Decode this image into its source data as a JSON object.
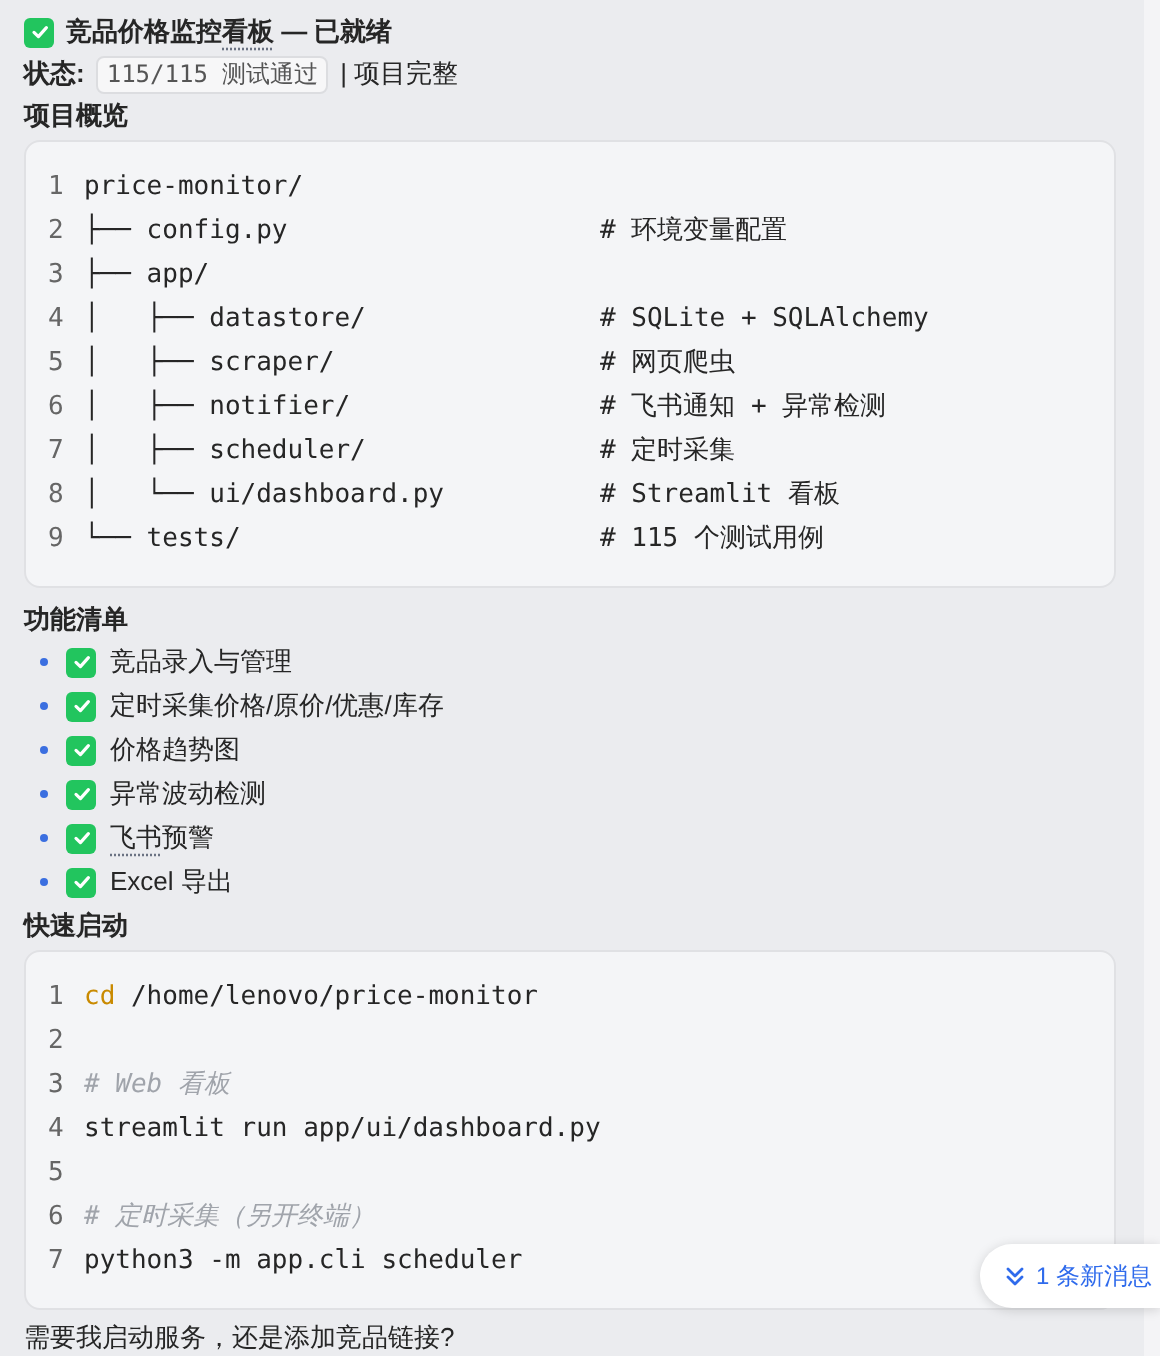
{
  "header": {
    "checked": true,
    "title": [
      {
        "text": "竞品价格监控",
        "term": false
      },
      {
        "text": "看板",
        "term": true
      },
      {
        "text": " — 已就绪",
        "term": false
      }
    ]
  },
  "status": {
    "label": "状态:",
    "code": "115/115 测试通过",
    "text": "| 项目完整"
  },
  "overview": {
    "heading": "项目概览",
    "lines": [
      {
        "number": "1",
        "path": "price-monitor/"
      },
      {
        "number": "2",
        "path": "├── config.py",
        "comment": "# 环境变量配置"
      },
      {
        "number": "3",
        "path": "├── app/"
      },
      {
        "number": "4",
        "path": "│   ├── datastore/",
        "comment": "# SQLite + SQLAlchemy"
      },
      {
        "number": "5",
        "path": "│   ├── scraper/",
        "comment": "# 网页爬虫"
      },
      {
        "number": "6",
        "path": "│   ├── notifier/",
        "comment": "# 飞书通知 + 异常检测"
      },
      {
        "number": "7",
        "path": "│   ├── scheduler/",
        "comment": "# 定时采集"
      },
      {
        "number": "8",
        "path": "│   └── ui/dashboard.py",
        "comment": "# Streamlit 看板"
      },
      {
        "number": "9",
        "path": "└── tests/",
        "comment": "# 115 个测试用例"
      }
    ]
  },
  "features": {
    "heading": "功能清单",
    "items": [
      {
        "checked": true,
        "segments": [
          {
            "text": "竞品录入与管理",
            "term": false
          }
        ]
      },
      {
        "checked": true,
        "segments": [
          {
            "text": "定时采集价格/原价/优惠/库存",
            "term": false
          }
        ]
      },
      {
        "checked": true,
        "segments": [
          {
            "text": "价格趋势图",
            "term": false
          }
        ]
      },
      {
        "checked": true,
        "segments": [
          {
            "text": "异常波动检测",
            "term": false
          }
        ]
      },
      {
        "checked": true,
        "segments": [
          {
            "text": "飞书",
            "term": true
          },
          {
            "text": "预警",
            "term": false
          }
        ]
      },
      {
        "checked": true,
        "segments": [
          {
            "text": "Excel 导出",
            "term": false
          }
        ]
      }
    ]
  },
  "quickstart": {
    "heading": "快速启动",
    "lines": [
      {
        "number": "1",
        "kind": "command",
        "keyword": "cd",
        "text": "/home/lenovo/price-monitor"
      },
      {
        "number": "2",
        "kind": "blank"
      },
      {
        "number": "3",
        "kind": "comment",
        "text": "# Web 看板"
      },
      {
        "number": "4",
        "kind": "plain",
        "text": "streamlit run app/ui/dashboard.py"
      },
      {
        "number": "5",
        "kind": "blank"
      },
      {
        "number": "6",
        "kind": "comment",
        "text": "# 定时采集（另开终端）"
      },
      {
        "number": "7",
        "kind": "plain",
        "text": "python3 -m app.cli scheduler"
      }
    ]
  },
  "new_messages": "1 条新消息",
  "question": "需要我启动服务，还是添加竞品链接?"
}
